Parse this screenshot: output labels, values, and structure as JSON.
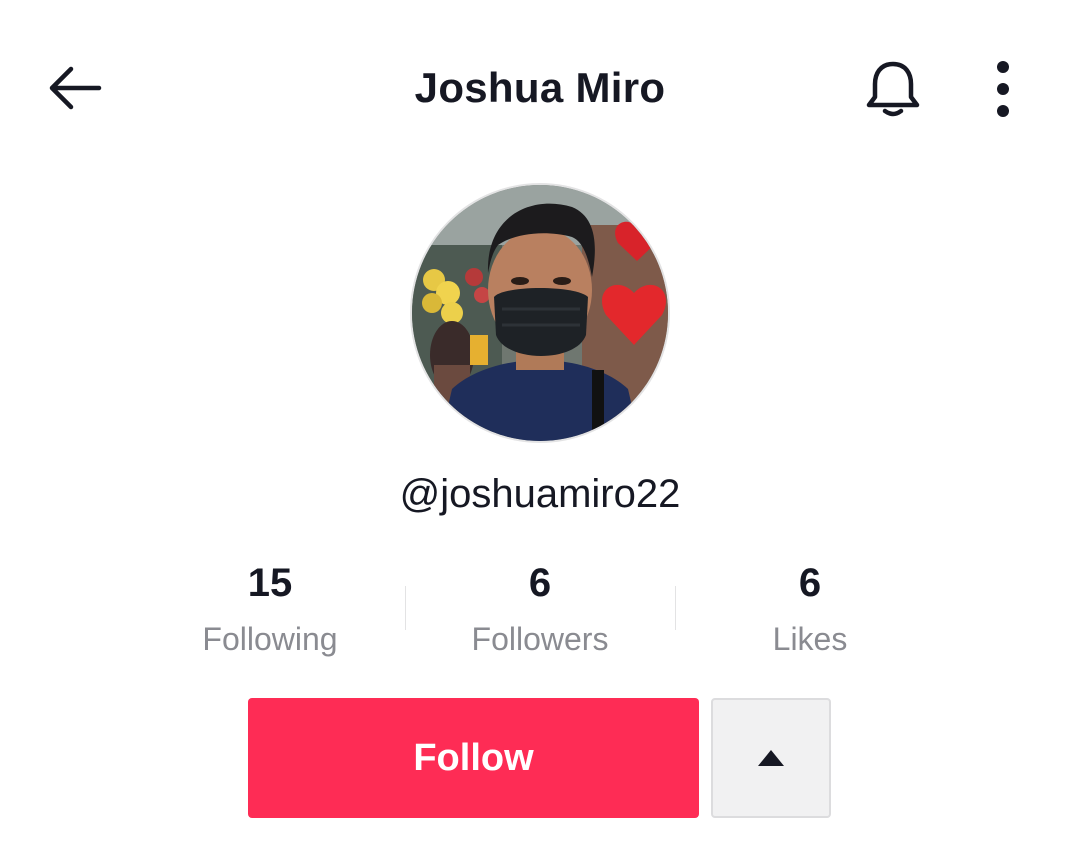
{
  "header": {
    "title": "Joshua Miro",
    "back_icon": "arrow-left-icon",
    "bell_icon": "bell-icon",
    "more_icon": "more-vertical-icon"
  },
  "profile": {
    "username": "@joshuamiro22"
  },
  "stats": [
    {
      "value": "15",
      "label": "Following"
    },
    {
      "value": "6",
      "label": "Followers"
    },
    {
      "value": "6",
      "label": "Likes"
    }
  ],
  "actions": {
    "follow_label": "Follow",
    "suggested_icon": "caret-up-icon"
  },
  "colors": {
    "accent": "#fe2c55",
    "text_primary": "#161823",
    "text_secondary": "#8a8b91"
  }
}
